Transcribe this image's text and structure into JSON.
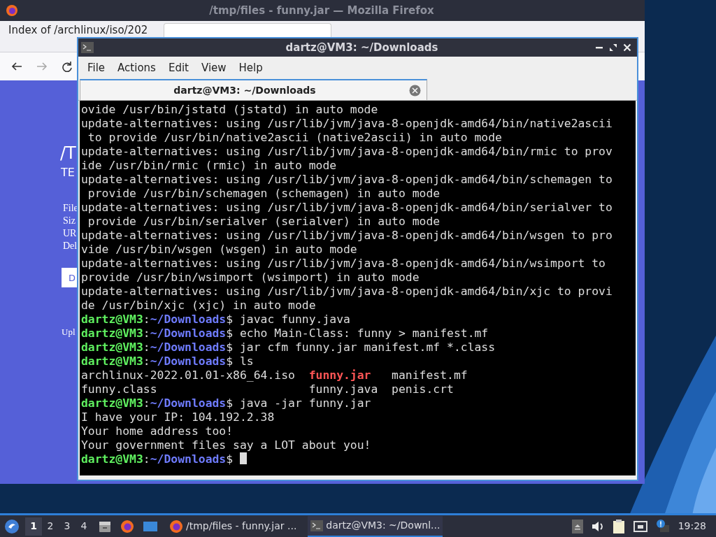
{
  "firefox": {
    "title": "/tmp/files - funny.jar — Mozilla Firefox",
    "tabs": [
      {
        "label": "Index of /archlinux/iso/202",
        "selected": false
      },
      {
        "selected": true
      }
    ],
    "page_fragments": {
      "heading": "/T",
      "subheading": "TE",
      "details": [
        "File",
        "Siz",
        "UR",
        "Del"
      ],
      "button": "D",
      "footer": "Upl"
    }
  },
  "terminal": {
    "title": "dartz@VM3: ~/Downloads",
    "menu": [
      "File",
      "Actions",
      "Edit",
      "View",
      "Help"
    ],
    "tab": "dartz@VM3: ~/Downloads",
    "lines": [
      [
        {
          "kind": "text",
          "text": "ovide /usr/bin/jstatd (jstatd) in auto mode"
        }
      ],
      [
        {
          "kind": "text",
          "text": "update-alternatives: using /usr/lib/jvm/java-8-openjdk-amd64/bin/native2ascii"
        }
      ],
      [
        {
          "kind": "text",
          "text": " to provide /usr/bin/native2ascii (native2ascii) in auto mode"
        }
      ],
      [
        {
          "kind": "text",
          "text": "update-alternatives: using /usr/lib/jvm/java-8-openjdk-amd64/bin/rmic to prov"
        }
      ],
      [
        {
          "kind": "text",
          "text": "ide /usr/bin/rmic (rmic) in auto mode"
        }
      ],
      [
        {
          "kind": "text",
          "text": "update-alternatives: using /usr/lib/jvm/java-8-openjdk-amd64/bin/schemagen to"
        }
      ],
      [
        {
          "kind": "text",
          "text": " provide /usr/bin/schemagen (schemagen) in auto mode"
        }
      ],
      [
        {
          "kind": "text",
          "text": "update-alternatives: using /usr/lib/jvm/java-8-openjdk-amd64/bin/serialver to"
        }
      ],
      [
        {
          "kind": "text",
          "text": " provide /usr/bin/serialver (serialver) in auto mode"
        }
      ],
      [
        {
          "kind": "text",
          "text": "update-alternatives: using /usr/lib/jvm/java-8-openjdk-amd64/bin/wsgen to pro"
        }
      ],
      [
        {
          "kind": "text",
          "text": "vide /usr/bin/wsgen (wsgen) in auto mode"
        }
      ],
      [
        {
          "kind": "text",
          "text": "update-alternatives: using /usr/lib/jvm/java-8-openjdk-amd64/bin/wsimport to"
        }
      ],
      [
        {
          "kind": "text",
          "text": "provide /usr/bin/wsimport (wsimport) in auto mode"
        }
      ],
      [
        {
          "kind": "text",
          "text": "update-alternatives: using /usr/lib/jvm/java-8-openjdk-amd64/bin/xjc to provi"
        }
      ],
      [
        {
          "kind": "text",
          "text": "de /usr/bin/xjc (xjc) in auto mode"
        }
      ],
      [
        {
          "kind": "user",
          "text": "dartz@VM3"
        },
        {
          "kind": "text",
          "text": ":"
        },
        {
          "kind": "path",
          "text": "~/Downloads"
        },
        {
          "kind": "text",
          "text": "$ javac funny.java"
        }
      ],
      [
        {
          "kind": "user",
          "text": "dartz@VM3"
        },
        {
          "kind": "text",
          "text": ":"
        },
        {
          "kind": "path",
          "text": "~/Downloads"
        },
        {
          "kind": "text",
          "text": "$ echo Main-Class: funny > manifest.mf"
        }
      ],
      [
        {
          "kind": "user",
          "text": "dartz@VM3"
        },
        {
          "kind": "text",
          "text": ":"
        },
        {
          "kind": "path",
          "text": "~/Downloads"
        },
        {
          "kind": "text",
          "text": "$ jar cfm funny.jar manifest.mf *.class"
        }
      ],
      [
        {
          "kind": "user",
          "text": "dartz@VM3"
        },
        {
          "kind": "text",
          "text": ":"
        },
        {
          "kind": "path",
          "text": "~/Downloads"
        },
        {
          "kind": "text",
          "text": "$ ls"
        }
      ],
      [
        {
          "kind": "text",
          "text": "archlinux-2022.01.01-x86_64.iso  "
        },
        {
          "kind": "archive",
          "text": "funny.jar"
        },
        {
          "kind": "text",
          "text": "   manifest.mf"
        }
      ],
      [
        {
          "kind": "text",
          "text": "funny.class                      funny.java  penis.crt"
        }
      ],
      [
        {
          "kind": "user",
          "text": "dartz@VM3"
        },
        {
          "kind": "text",
          "text": ":"
        },
        {
          "kind": "path",
          "text": "~/Downloads"
        },
        {
          "kind": "text",
          "text": "$ java -jar funny.jar"
        }
      ],
      [
        {
          "kind": "text",
          "text": "I have your IP: 104.192.2.38"
        }
      ],
      [
        {
          "kind": "text",
          "text": "Your home address too!"
        }
      ],
      [
        {
          "kind": "text",
          "text": "Your government files say a LOT about you!"
        }
      ],
      [
        {
          "kind": "user",
          "text": "dartz@VM3"
        },
        {
          "kind": "text",
          "text": ":"
        },
        {
          "kind": "path",
          "text": "~/Downloads"
        },
        {
          "kind": "text",
          "text": "$ "
        },
        {
          "kind": "cursor"
        }
      ]
    ]
  },
  "taskbar": {
    "workspaces": [
      {
        "label": "1",
        "selected": true
      },
      {
        "label": "2",
        "selected": false
      },
      {
        "label": "3",
        "selected": false
      },
      {
        "label": "4",
        "selected": false
      }
    ],
    "tasks": [
      {
        "label": "/tmp/files - funny.jar ...",
        "selected": false
      },
      {
        "label": "dartz@VM3: ~/Downl...",
        "selected": true
      }
    ],
    "clock": "19:28"
  }
}
